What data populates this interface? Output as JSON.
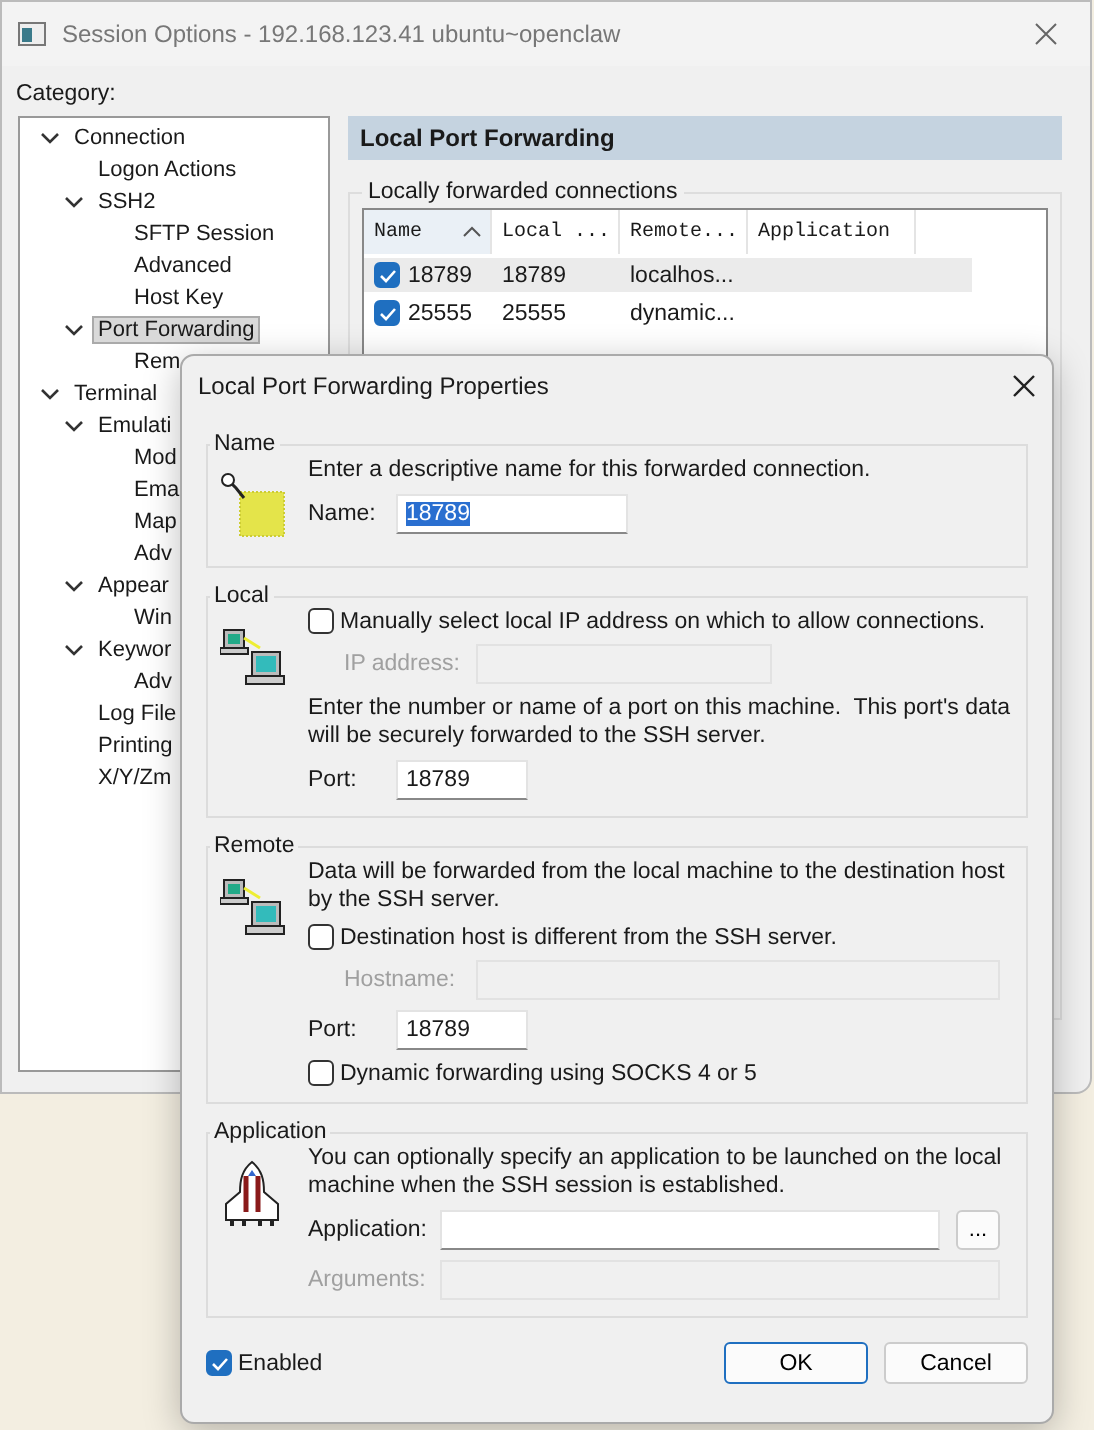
{
  "window": {
    "title": "Session Options - 192.168.123.41 ubuntu~openclaw"
  },
  "category_label": "Category:",
  "tree": [
    {
      "label": "Connection",
      "selected": false,
      "expanded": true,
      "children": [
        {
          "label": "Logon Actions",
          "selected": false
        },
        {
          "label": "SSH2",
          "selected": false,
          "expanded": true,
          "children": [
            {
              "label": "SFTP Session",
              "selected": false
            },
            {
              "label": "Advanced",
              "selected": false
            },
            {
              "label": "Host Key",
              "selected": false
            }
          ]
        },
        {
          "label": "Port Forwarding",
          "selected": true,
          "expanded": true,
          "children": [
            {
              "label": "Rem",
              "selected": false
            }
          ]
        }
      ]
    },
    {
      "label": "Terminal",
      "selected": false,
      "expanded": true,
      "children": [
        {
          "label": "Emulati",
          "selected": false,
          "expanded": true,
          "children": [
            {
              "label": "Mod",
              "selected": false
            },
            {
              "label": "Ema",
              "selected": false
            },
            {
              "label": "Map",
              "selected": false
            },
            {
              "label": "Adv",
              "selected": false
            }
          ]
        },
        {
          "label": "Appear",
          "selected": false,
          "expanded": true,
          "children": [
            {
              "label": "Win",
              "selected": false
            }
          ]
        },
        {
          "label": "Keywor",
          "selected": false,
          "expanded": true,
          "children": [
            {
              "label": "Adv",
              "selected": false
            }
          ]
        },
        {
          "label": "Log File",
          "selected": false
        },
        {
          "label": "Printing",
          "selected": false
        },
        {
          "label": "X/Y/Zm",
          "selected": false
        }
      ]
    }
  ],
  "panel": {
    "title": "Local Port Forwarding",
    "group_label": "Locally forwarded connections",
    "table": {
      "columns": [
        {
          "label": "Name",
          "sorted": true
        },
        {
          "label": "Local ...",
          "sorted": false
        },
        {
          "label": "Remote...",
          "sorted": false
        },
        {
          "label": "Application",
          "sorted": false
        }
      ],
      "rows": [
        {
          "checked": true,
          "selected": true,
          "cells": [
            "18789",
            "18789",
            "localhos..."
          ]
        },
        {
          "checked": true,
          "selected": false,
          "cells": [
            "25555",
            "25555",
            "dynamic..."
          ]
        }
      ]
    }
  },
  "dialog": {
    "title": "Local Port Forwarding Properties",
    "name_group": {
      "label": "Name",
      "description": "Enter a descriptive name for this forwarded connection.",
      "field": {
        "label": "Name:",
        "value": "18789",
        "value_selected": true
      }
    },
    "local_group": {
      "label": "Local",
      "checkbox": {
        "label": "Manually select local IP address on which to allow connections.",
        "checked": false
      },
      "ip_field": {
        "label": "IP address:",
        "disabled": true
      },
      "description": "Enter the number or name of a port on this machine.  This port's data will be securely forwarded to the SSH server.",
      "port_field": {
        "label": "Port:",
        "value": "18789"
      }
    },
    "remote_group": {
      "label": "Remote",
      "description": "Data will be forwarded from the local machine to the destination host by the SSH server.",
      "host_checkbox": {
        "label": "Destination host is different from the SSH server.",
        "checked": false
      },
      "hostname_field": {
        "label": "Hostname:",
        "disabled": true
      },
      "port_field": {
        "label": "Port:",
        "value": "18789"
      },
      "socks_checkbox": {
        "label": "Dynamic forwarding using SOCKS 4 or 5",
        "checked": false
      }
    },
    "application_group": {
      "label": "Application",
      "description": "You can optionally specify an application to be launched on the local machine when the SSH session is established.",
      "application_field": {
        "label": "Application:",
        "disabled": false
      },
      "browse_button": "...",
      "arguments_field": {
        "label": "Arguments:",
        "disabled": true
      }
    },
    "enabled": {
      "label": "Enabled",
      "checked": true
    },
    "buttons": [
      {
        "label": "OK",
        "default": true
      },
      {
        "label": "Cancel",
        "default": false
      }
    ]
  }
}
